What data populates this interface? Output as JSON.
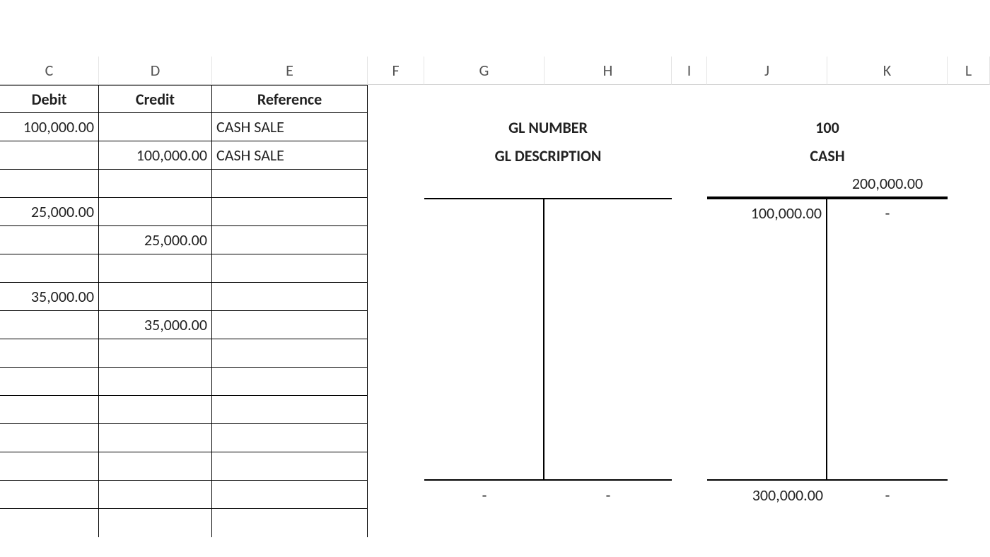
{
  "columns": [
    "C",
    "D",
    "E",
    "F",
    "G",
    "H",
    "I",
    "J",
    "K",
    "L"
  ],
  "headers": {
    "debit": "Debit",
    "credit": "Credit",
    "reference": "Reference"
  },
  "ledger_rows": [
    {
      "debit": "100,000.00",
      "credit": "",
      "reference": "CASH SALE"
    },
    {
      "debit": "",
      "credit": "100,000.00",
      "reference": "CASH SALE"
    },
    {
      "debit": "",
      "credit": "",
      "reference": ""
    },
    {
      "debit": "25,000.00",
      "credit": "",
      "reference": ""
    },
    {
      "debit": "",
      "credit": "25,000.00",
      "reference": ""
    },
    {
      "debit": "",
      "credit": "",
      "reference": ""
    },
    {
      "debit": "35,000.00",
      "credit": "",
      "reference": ""
    },
    {
      "debit": "",
      "credit": "35,000.00",
      "reference": ""
    },
    {
      "debit": "",
      "credit": "",
      "reference": ""
    },
    {
      "debit": "",
      "credit": "",
      "reference": ""
    },
    {
      "debit": "",
      "credit": "",
      "reference": ""
    },
    {
      "debit": "",
      "credit": "",
      "reference": ""
    },
    {
      "debit": "",
      "credit": "",
      "reference": ""
    },
    {
      "debit": "",
      "credit": "",
      "reference": ""
    },
    {
      "debit": "",
      "credit": "",
      "reference": ""
    }
  ],
  "gl": {
    "number_label": "GL NUMBER",
    "desc_label": "GL DESCRIPTION",
    "number_value": "100",
    "desc_value": "CASH"
  },
  "t_left": {
    "sum_left": "-",
    "sum_right": "-"
  },
  "t_right": {
    "header_right": "200,000.00",
    "row1_left": "100,000.00",
    "row1_right": "-",
    "sum_left": "300,000.00",
    "sum_right": "-"
  }
}
